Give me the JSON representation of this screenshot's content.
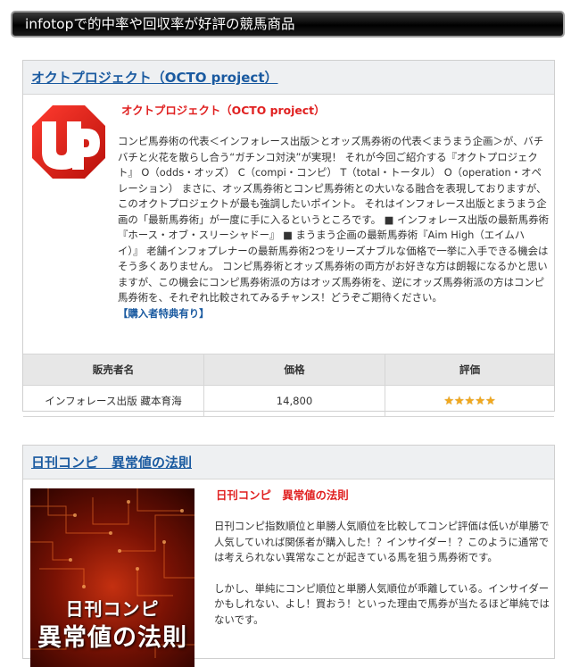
{
  "header": {
    "title": "infotopで的中率や回収率が好評の競馬商品"
  },
  "products": [
    {
      "title_link": "オクトプロジェクト（OCTO project）",
      "name": "オクトプロジェクト（OCTO project）",
      "image_icon": "octo-project-logo",
      "description": "コンピ馬券術の代表＜インフォレース出版＞とオッズ馬券術の代表＜まうまう企画＞が、バチバチと火花を散らし合う“ガチンコ対決”が実現！ それが今回ご紹介する『オクトプロジェクト』 O（odds・オッズ） C（compi・コンピ） T（total・トータル） O（operation・オペレーション） まさに、オッズ馬券術とコンピ馬券術との大いなる融合を表現しておりますが、このオクトプロジェクトが最も強調したいポイント。 それはインフォレース出版とまうまう企画の「最新馬券術」が一度に手に入るというところです。 ■ インフォレース出版の最新馬券術『ホース・オブ・スリーシャドー』 ■ まうまう企画の最新馬券術『Aim High（エイムハイ）』 老舗インフォプレナーの最新馬券術2つをリーズナブルな価格で一挙に入手できる機会はそう多くありません。 コンピ馬券術とオッズ馬券術の両方がお好きな方は朗報になるかと思いますが、この機会にコンピ馬券術派の方はオッズ馬券術を、逆にオッズ馬券術派の方はコンピ馬券術を、それぞれ比較されてみるチャンス！どうぞご期待ください。",
      "benefit": "【購入者特典有り】",
      "table": {
        "headers": [
          "販売者名",
          "価格",
          "評価"
        ],
        "seller": "インフォレース出版 藏本育海",
        "price": "14,800",
        "rating_stars": 5
      }
    },
    {
      "title_link": "日刊コンピ　異常値の法則",
      "name": "日刊コンピ　異常値の法則",
      "cover_line1": "日刊コンピ",
      "cover_line2": "異常値の法則",
      "paragraphs": [
        "日刊コンピ指数順位と単勝人気順位を比較してコンピ評価は低いが単勝で人気していれば関係者が購入した！？インサイダー！？このように通常では考えられない異常なことが起きている馬を狙う馬券術です。",
        "しかし、単純にコンピ順位と単勝人気順位が乖離している。インサイダーかもしれない、よし！買おう！といった理由で馬券が当たるほど単純ではないです。"
      ]
    }
  ],
  "colors": {
    "link_blue": "#1a5aa0",
    "product_red": "#e02020",
    "star_gold": "#f2a81d"
  }
}
